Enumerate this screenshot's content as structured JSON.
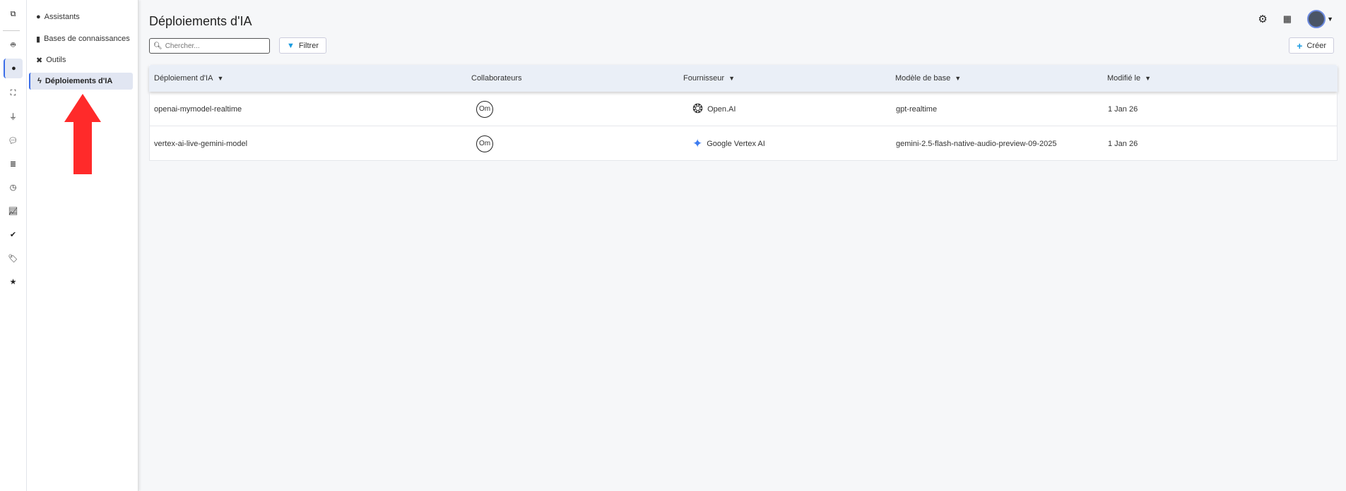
{
  "rail": {
    "items": [
      "sidebar-toggle",
      "robot",
      "brain",
      "sitemap",
      "plug",
      "comments",
      "database",
      "clock",
      "chart",
      "check-circle",
      "tag",
      "star"
    ]
  },
  "panel": {
    "items": [
      {
        "label": "Assistants",
        "icon": "brain"
      },
      {
        "label": "Bases de connaissances",
        "icon": "book"
      },
      {
        "label": "Outils",
        "icon": "tools"
      },
      {
        "label": "Déploiements d'IA",
        "icon": "bolt",
        "active": true
      }
    ]
  },
  "header": {
    "title": "Déploiements d'IA",
    "search_placeholder": "Chercher...",
    "filter_label": "Filtrer",
    "create_label": "Créer"
  },
  "table": {
    "columns": [
      "Déploiement d'IA",
      "Collaborateurs",
      "Fournisseur",
      "Modèle de base",
      "Modifié le"
    ],
    "rows": [
      {
        "name": "openai-mymodel-realtime",
        "collaborator": "Om",
        "provider": "Open.AI",
        "model": "gpt-realtime",
        "modified": "1 Jan 26"
      },
      {
        "name": "vertex-ai-live-gemini-model",
        "collaborator": "Om",
        "provider": "Google Vertex AI",
        "model": "gemini-2.5-flash-native-audio-preview-09-2025",
        "modified": "1 Jan 26"
      }
    ]
  },
  "colors": {
    "accent": "#3b6ee8",
    "annotation_arrow": "#ff2a2a",
    "filter_icon": "#1a9be0"
  }
}
